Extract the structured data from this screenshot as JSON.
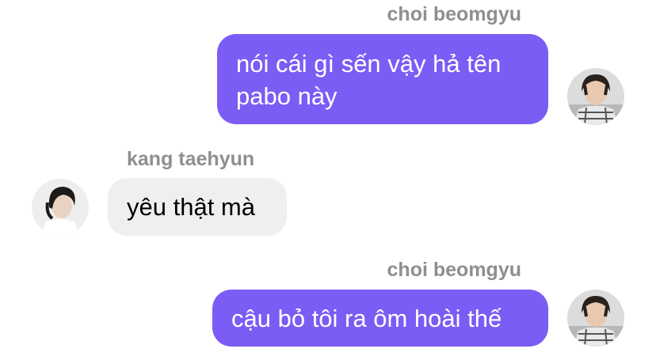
{
  "messages": [
    {
      "sender": "choi beomgyu",
      "direction": "outgoing",
      "text": "nói cái gì sến vậy hả tên\npabo này",
      "avatar_icon": "beomgyu-avatar-icon"
    },
    {
      "sender": "kang taehyun",
      "direction": "incoming",
      "text": "yêu thật mà",
      "avatar_icon": "taehyun-avatar-icon"
    },
    {
      "sender": "choi beomgyu",
      "direction": "outgoing",
      "text": "cậu bỏ tôi ra ôm hoài thế",
      "avatar_icon": "beomgyu-avatar-icon"
    }
  ],
  "colors": {
    "outgoing_bubble": "#7b5cf5",
    "incoming_bubble": "#efeff0",
    "sender_name": "#8e8e93"
  }
}
